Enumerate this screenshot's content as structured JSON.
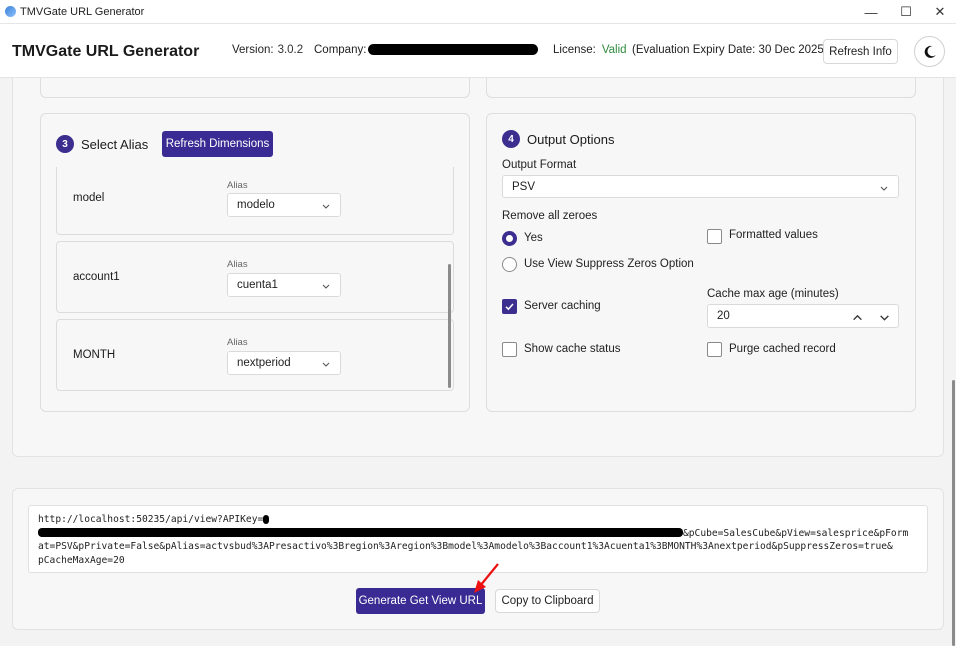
{
  "window": {
    "title": "TMVGate URL Generator",
    "minimize": "—",
    "maximize": "☐",
    "close": "✕"
  },
  "header": {
    "brand": "TMVGate URL Generator",
    "version_label": "Version:",
    "version_value": "3.0.2",
    "company_label": "Company:",
    "license_label": "License:",
    "license_value": "Valid",
    "expiry": "(Evaluation Expiry Date: 30 Dec 2025)",
    "refresh_info": "Refresh Info",
    "license_color": "#2e8b3e"
  },
  "alias_section": {
    "step": "3",
    "title": "Select Alias",
    "refresh_button": "Refresh Dimensions",
    "alias_label": "Alias",
    "rows": [
      {
        "dimension": "model",
        "alias": "modelo"
      },
      {
        "dimension": "account1",
        "alias": "cuenta1"
      },
      {
        "dimension": "MONTH",
        "alias": "nextperiod"
      }
    ]
  },
  "output_section": {
    "step": "4",
    "title": "Output Options",
    "format_label": "Output Format",
    "format_value": "PSV",
    "zeroes_label": "Remove all zeroes",
    "zeroes_yes": "Yes",
    "zeroes_suppress": "Use View Suppress Zeros Option",
    "formatted_values": "Formatted values",
    "server_caching": "Server caching",
    "cache_max_age_label": "Cache max age (minutes)",
    "cache_max_age_value": "20",
    "show_cache_status": "Show cache status",
    "purge_cached_record": "Purge cached record",
    "accent": "#3b2e8f"
  },
  "url": {
    "line1": "http://localhost:50235/api/view?APIKey=",
    "line2_tail": "&pCube=SalesCube&pView=salesprice&pForm",
    "line3": "at=PSV&pPrivate=False&pAlias=actvsbud%3APresactivo%3Bregion%3Aregion%3Bmodel%3Amodelo%3Baccount1%3Acuenta1%3BMONTH%3Anextperiod&pSuppressZeros=true&",
    "line4": "pCacheMaxAge=20"
  },
  "actions": {
    "generate": "Generate Get View URL",
    "copy": "Copy to Clipboard"
  }
}
